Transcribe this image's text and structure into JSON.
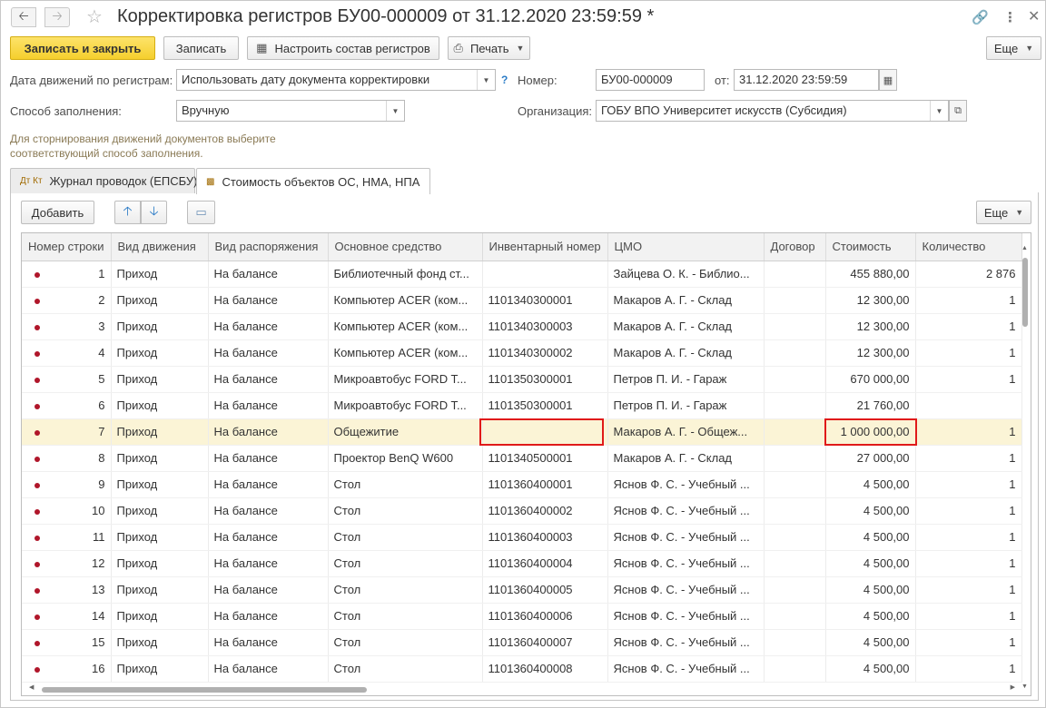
{
  "window": {
    "title": "Корректировка регистров БУ00-000009 от 31.12.2020 23:59:59 *"
  },
  "icons": {
    "back": "arrow-left-icon",
    "forward": "arrow-right-icon",
    "favorite": "star-icon",
    "link": "link-icon",
    "more": "more-vertical-icon",
    "close": "close-icon"
  },
  "toolbar": {
    "save_close": "Записать и закрыть",
    "save": "Записать",
    "configure": "Настроить состав регистров",
    "print": "Печать",
    "more": "Еще"
  },
  "form": {
    "date_label": "Дата движений по регистрам:",
    "date_value": "Использовать дату документа корректировки",
    "help": "?",
    "number_label": "Номер:",
    "number_value": "БУ00-000009",
    "from_label": "от:",
    "from_value": "31.12.2020 23:59:59",
    "fill_label": "Способ заполнения:",
    "fill_value": "Вручную",
    "org_label": "Организация:",
    "org_value": "ГОБУ ВПО Университет искусств (Субсидия)",
    "hint": "Для сторнирования движений документов выберите соответствующий способ заполнения."
  },
  "tabs": [
    {
      "label": "Журнал проводок (ЕПСБУ)",
      "icon_text": "Дт Кт"
    },
    {
      "label": "Стоимость объектов ОС, НМА, НПА"
    }
  ],
  "table_toolbar": {
    "add": "Добавить",
    "more": "Еще"
  },
  "columns": [
    "Номер строки",
    "Вид движения",
    "Вид распоряжения",
    "Основное средство",
    "Инвентарный номер",
    "ЦМО",
    "Договор",
    "Стоимость",
    "Количество"
  ],
  "rows": [
    {
      "n": "1",
      "move": "Приход",
      "disp": "На балансе",
      "asset": "Библиотечный фонд ст...",
      "inv": "",
      "cmo": "Зайцева О. К. - Библио...",
      "contract": "",
      "cost": "455 880,00",
      "qty": "2 876"
    },
    {
      "n": "2",
      "move": "Приход",
      "disp": "На балансе",
      "asset": "Компьютер ACER (ком...",
      "inv": "1101340300001",
      "cmo": "Макаров А. Г. - Склад",
      "contract": "",
      "cost": "12 300,00",
      "qty": "1"
    },
    {
      "n": "3",
      "move": "Приход",
      "disp": "На балансе",
      "asset": "Компьютер ACER (ком...",
      "inv": "1101340300003",
      "cmo": "Макаров А. Г. - Склад",
      "contract": "",
      "cost": "12 300,00",
      "qty": "1"
    },
    {
      "n": "4",
      "move": "Приход",
      "disp": "На балансе",
      "asset": "Компьютер ACER (ком...",
      "inv": "1101340300002",
      "cmo": "Макаров А. Г. - Склад",
      "contract": "",
      "cost": "12 300,00",
      "qty": "1"
    },
    {
      "n": "5",
      "move": "Приход",
      "disp": "На балансе",
      "asset": "Микроавтобус FORD T...",
      "inv": "1101350300001",
      "cmo": "Петров П. И. - Гараж",
      "contract": "",
      "cost": "670 000,00",
      "qty": "1"
    },
    {
      "n": "6",
      "move": "Приход",
      "disp": "На балансе",
      "asset": "Микроавтобус FORD T...",
      "inv": "1101350300001",
      "cmo": "Петров П. И. - Гараж",
      "contract": "",
      "cost": "21 760,00",
      "qty": ""
    },
    {
      "n": "7",
      "move": "Приход",
      "disp": "На балансе",
      "asset": "Общежитие",
      "inv": "",
      "cmo": "Макаров А. Г. - Общеж...",
      "contract": "",
      "cost": "1 000 000,00",
      "qty": "1"
    },
    {
      "n": "8",
      "move": "Приход",
      "disp": "На балансе",
      "asset": "Проектор BenQ W600",
      "inv": "1101340500001",
      "cmo": "Макаров А. Г. - Склад",
      "contract": "",
      "cost": "27 000,00",
      "qty": "1"
    },
    {
      "n": "9",
      "move": "Приход",
      "disp": "На балансе",
      "asset": "Стол",
      "inv": "1101360400001",
      "cmo": "Яснов Ф. С. - Учебный ...",
      "contract": "",
      "cost": "4 500,00",
      "qty": "1"
    },
    {
      "n": "10",
      "move": "Приход",
      "disp": "На балансе",
      "asset": "Стол",
      "inv": "1101360400002",
      "cmo": "Яснов Ф. С. - Учебный ...",
      "contract": "",
      "cost": "4 500,00",
      "qty": "1"
    },
    {
      "n": "11",
      "move": "Приход",
      "disp": "На балансе",
      "asset": "Стол",
      "inv": "1101360400003",
      "cmo": "Яснов Ф. С. - Учебный ...",
      "contract": "",
      "cost": "4 500,00",
      "qty": "1"
    },
    {
      "n": "12",
      "move": "Приход",
      "disp": "На балансе",
      "asset": "Стол",
      "inv": "1101360400004",
      "cmo": "Яснов Ф. С. - Учебный ...",
      "contract": "",
      "cost": "4 500,00",
      "qty": "1"
    },
    {
      "n": "13",
      "move": "Приход",
      "disp": "На балансе",
      "asset": "Стол",
      "inv": "1101360400005",
      "cmo": "Яснов Ф. С. - Учебный ...",
      "contract": "",
      "cost": "4 500,00",
      "qty": "1"
    },
    {
      "n": "14",
      "move": "Приход",
      "disp": "На балансе",
      "asset": "Стол",
      "inv": "1101360400006",
      "cmo": "Яснов Ф. С. - Учебный ...",
      "contract": "",
      "cost": "4 500,00",
      "qty": "1"
    },
    {
      "n": "15",
      "move": "Приход",
      "disp": "На балансе",
      "asset": "Стол",
      "inv": "1101360400007",
      "cmo": "Яснов Ф. С. - Учебный ...",
      "contract": "",
      "cost": "4 500,00",
      "qty": "1"
    },
    {
      "n": "16",
      "move": "Приход",
      "disp": "На балансе",
      "asset": "Стол",
      "inv": "1101360400008",
      "cmo": "Яснов Ф. С. - Учебный ...",
      "contract": "",
      "cost": "4 500,00",
      "qty": "1"
    }
  ],
  "selected_row": "7",
  "colors": {
    "primary_button": "#f5cf2d",
    "highlight_border": "#e01a1a",
    "selected_row_bg": "#fbf4d6",
    "row_marker": "#b0162a"
  }
}
